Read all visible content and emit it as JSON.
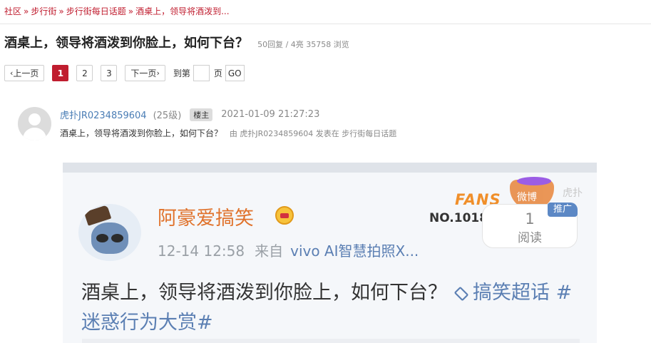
{
  "breadcrumb": {
    "items": [
      "社区",
      "步行街",
      "步行街每日话题",
      "酒桌上，领导将酒泼到..."
    ],
    "separator": "»"
  },
  "thread": {
    "title": "酒桌上，领导将酒泼到你脸上，如何下台？",
    "meta": "50回复 / 4亮 35758 浏览"
  },
  "pager": {
    "prev_label": "上一页",
    "pages": [
      "1",
      "2",
      "3"
    ],
    "active_page": "1",
    "next_label": "下一页",
    "goto_label": "到第",
    "goto_value": "",
    "page_unit": "页",
    "go_label": "GO"
  },
  "post": {
    "username": "虎扑JR0234859604",
    "level": "(25级)",
    "owner_badge": "楼主",
    "time": "2021-01-09 21:27:23",
    "content": "酒桌上，领导将酒泼到你脸上，如何下台？",
    "from_text": "由  虎扑JR0234859604 发表在  步行街每日话题"
  },
  "screenshot": {
    "name": "阿豪爱搞笑",
    "time": "12-14 12:58",
    "source": "来自",
    "device": "vivo AI智慧拍照X...",
    "fans_text": "FANS",
    "fans_no": "NO.1018",
    "ribbon_text": "微博",
    "read_count": "1",
    "read_label": "阅读",
    "promo_label": "推广",
    "text_main": "酒桌上，领导将酒泼到你脸上，如何下台？",
    "topic1": "搞笑超话",
    "topic2": "#迷惑行为大赏#",
    "watermark": "虎扑"
  },
  "colors": {
    "accent": "#c01d2f",
    "link": "#4a7db5",
    "weibo_name": "#e0722b",
    "weibo_link": "#5b7fb3"
  }
}
